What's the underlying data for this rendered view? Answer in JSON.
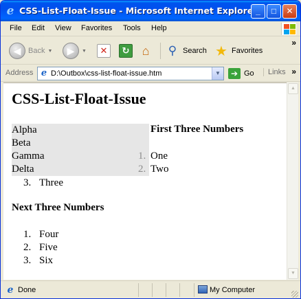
{
  "window": {
    "title": "CSS-List-Float-Issue - Microsoft Internet Explorer",
    "buttons": {
      "minimize": "_",
      "maximize": "□",
      "close": "✕"
    }
  },
  "menu": {
    "items": [
      "File",
      "Edit",
      "View",
      "Favorites",
      "Tools",
      "Help"
    ]
  },
  "toolbar": {
    "back_label": "Back",
    "search_label": "Search",
    "favorites_label": "Favorites",
    "overflow": "»"
  },
  "address_bar": {
    "label": "Address",
    "value": "D:\\Outbox\\css-list-float-issue.htm",
    "go_label": "Go",
    "links_label": "Links",
    "overflow": "»"
  },
  "page": {
    "heading": "CSS-List-Float-Issue",
    "float_list": [
      "Alpha",
      "Beta",
      "Gamma",
      "Delta"
    ],
    "section1": {
      "heading": "First Three Numbers",
      "items": [
        {
          "num": "1.",
          "text": "One"
        },
        {
          "num": "2.",
          "text": "Two"
        },
        {
          "num": "3.",
          "text": "Three"
        }
      ]
    },
    "section2": {
      "heading": "Next Three Numbers",
      "items": [
        {
          "num": "1.",
          "text": "Four"
        },
        {
          "num": "2.",
          "text": "Five"
        },
        {
          "num": "3.",
          "text": "Six"
        }
      ]
    }
  },
  "status_bar": {
    "status": "Done",
    "zone": "My Computer"
  },
  "colors": {
    "titlebar": "#0053ee",
    "float_bg": "#e6e6e6",
    "gray_number": "#8c8c8c"
  }
}
